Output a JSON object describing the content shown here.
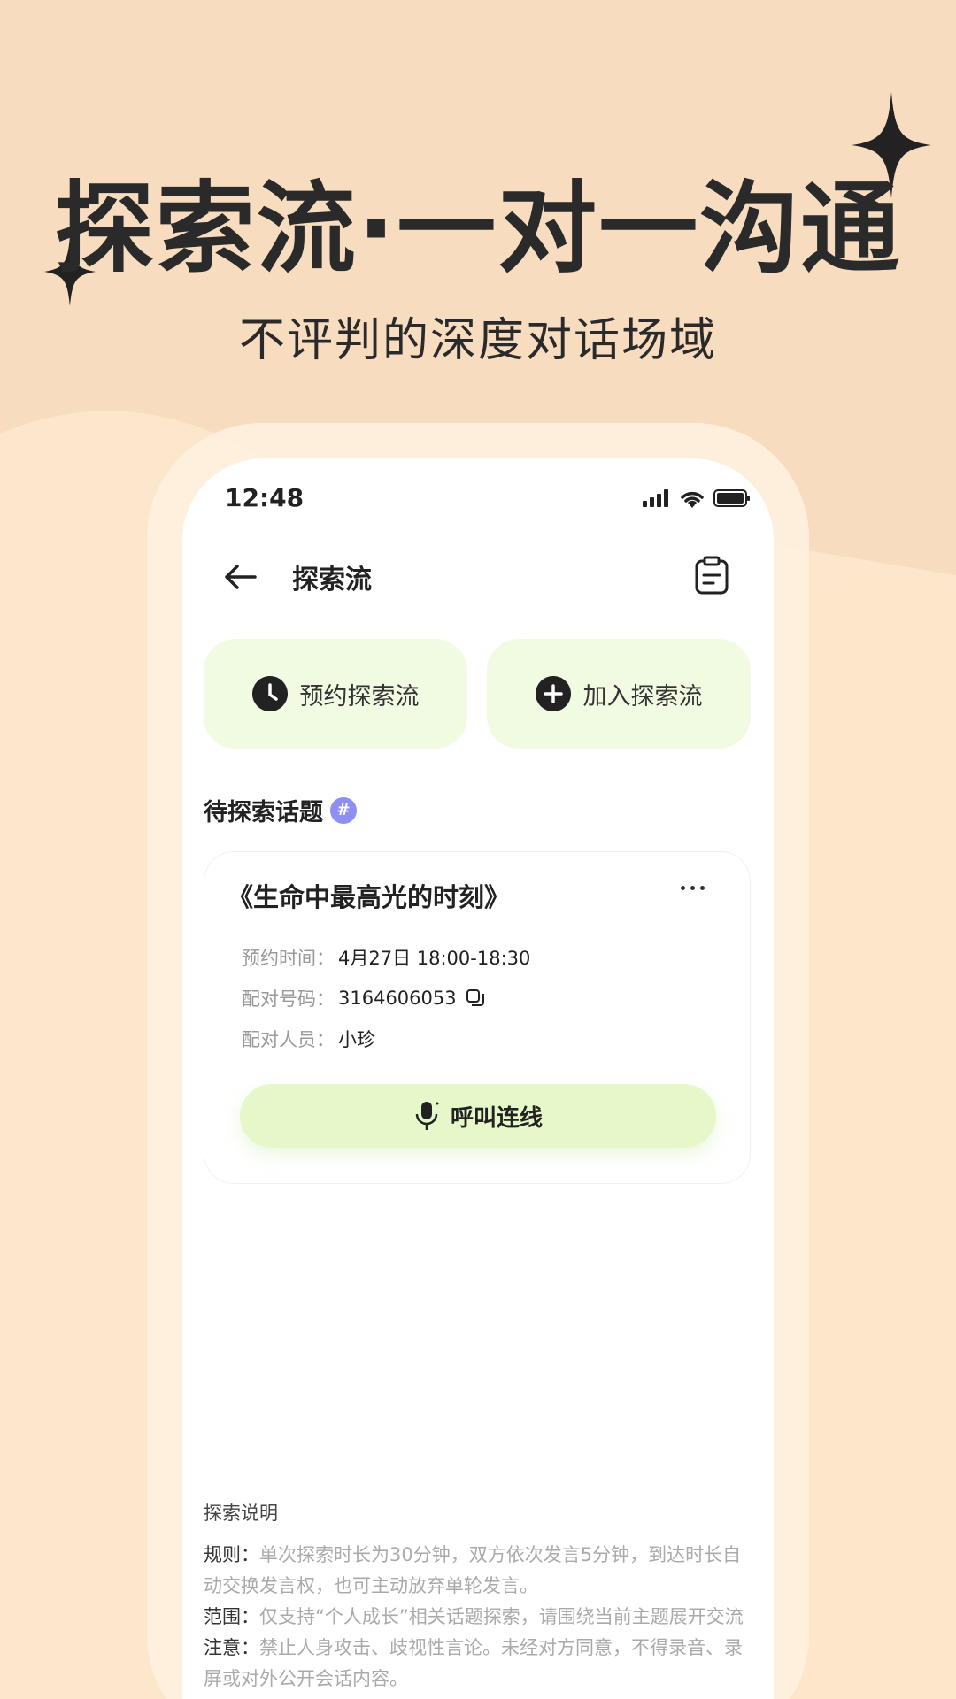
{
  "promo": {
    "headline": "探索流·一对一沟通",
    "subheadline": "不评判的深度对话场域"
  },
  "status_bar": {
    "time": "12:48"
  },
  "nav": {
    "title": "探索流"
  },
  "actions": {
    "reserve_label": "预约探索流",
    "join_label": "加入探索流"
  },
  "section": {
    "title": "待探索话题",
    "badge": "#"
  },
  "topic": {
    "title": "《生命中最高光的时刻》",
    "time_key": "预约时间：",
    "time_val": "4月27日 18:00-18:30",
    "code_key": "配对号码：",
    "code_val": "3164606053",
    "person_key": "配对人员：",
    "person_val": "小珍",
    "call_label": "呼叫连线"
  },
  "notes": {
    "title": "探索说明",
    "rule_key": "规则：",
    "rule_text": "单次探索时长为30分钟，双方依次发言5分钟，到达时长自动交换发言权，也可主动放弃单轮发言。",
    "scope_key": "范围：",
    "scope_text": "仅支持“个人成长”相关话题探索，请围绕当前主题展开交流",
    "caution_key": "注意：",
    "caution_text": "禁止人身攻击、歧视性言论。未经对方同意，不得录音、录屏或对外公开会话内容。"
  },
  "colors": {
    "background": "#f8dcc0",
    "action_bg": "#f1fbe2",
    "call_bg": "#e6f7c9",
    "badge": "#8e8ff2"
  }
}
